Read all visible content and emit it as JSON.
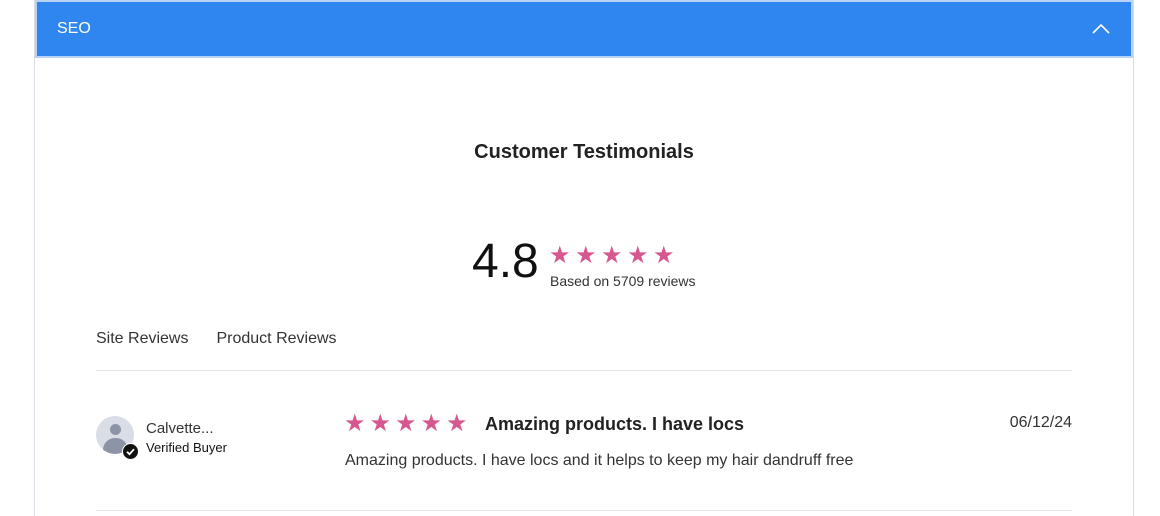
{
  "accordion": {
    "title": "SEO",
    "chevron_icon": "chevron-up-icon",
    "background_color": "#2f86ef"
  },
  "testimonials": {
    "title": "Customer Testimonials",
    "average_rating": "4.8",
    "average_stars": 5,
    "star_color": "#d6588e",
    "based_on": "Based on 5709 reviews"
  },
  "tabs": [
    {
      "label": "Site Reviews"
    },
    {
      "label": "Product Reviews"
    }
  ],
  "reviews": [
    {
      "reviewer_name": "Calvette...",
      "verified_label": "Verified Buyer",
      "rating": 5,
      "title": "Amazing products. I have locs",
      "date": "06/12/24",
      "body": "Amazing products. I have locs and it helps to keep my hair dandruff free"
    }
  ]
}
